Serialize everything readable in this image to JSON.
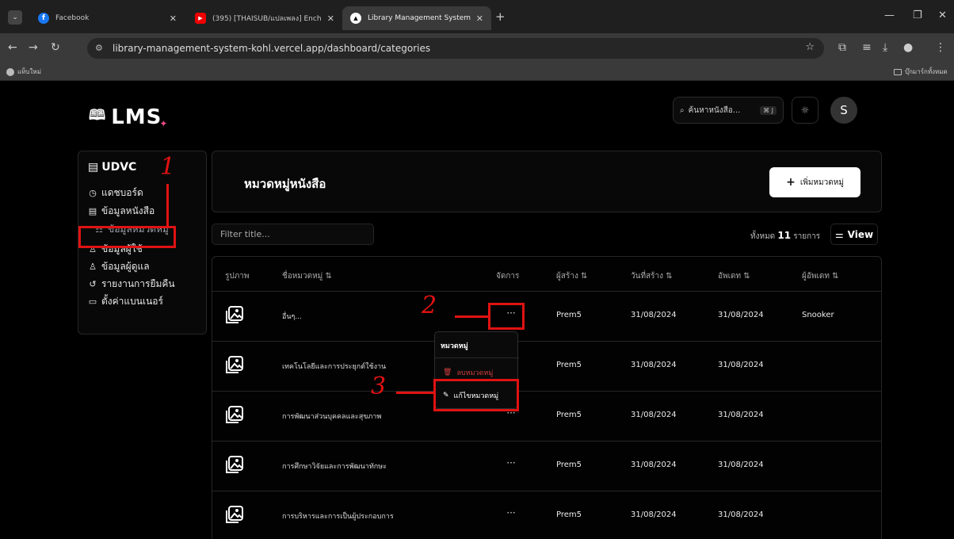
{
  "browser": {
    "tabs": [
      {
        "title": "Facebook",
        "favicon": "f"
      },
      {
        "title": "(395) [THAISUB/แปลเพลง] Ench",
        "favicon": "▶"
      },
      {
        "title": "Library Management System",
        "favicon": "▲"
      }
    ],
    "url": "library-management-system-kohl.vercel.app/dashboard/categories",
    "bookmark_left": "แท็บใหม่",
    "bookmark_right": "บุ๊กมาร์กทั้งหมด"
  },
  "app": {
    "logo_text": "LMS",
    "search_placeholder": "ค้นหาหนังสือ...",
    "search_shortcut": "⌘ J",
    "avatar_letter": "S"
  },
  "sidebar": {
    "title": "UDVC",
    "items": [
      {
        "label": "แดชบอร์ด",
        "icon": "◷"
      },
      {
        "label": "ข้อมูลหนังสือ",
        "icon": "▤"
      },
      {
        "label": "ข้อมูลหมวดหมู่",
        "icon": "☷"
      },
      {
        "label": "ข้อมูลผู้ใช้",
        "icon": "♙"
      },
      {
        "label": "ข้อมูลผู้ดูแล",
        "icon": "♙"
      },
      {
        "label": "รายงานการยืมคืน",
        "icon": "↺"
      },
      {
        "label": "ตั้งค่าแบนเนอร์",
        "icon": "▭"
      }
    ]
  },
  "main": {
    "title": "หมวดหมู่หนังสือ",
    "add_button": "เพิ่มหมวดหมู่",
    "filter_placeholder": "Filter title...",
    "total_prefix": "ทั้งหมด",
    "total_count": "11",
    "total_suffix": "รายการ",
    "view_button": "View",
    "columns": [
      "รูปภาพ",
      "ชื่อหมวดหมู่ ⇅",
      "จัดการ",
      "ผู้สร้าง ⇅",
      "วันที่สร้าง ⇅",
      "อัพเดท ⇅",
      "ผู้อัพเดท ⇅"
    ],
    "rows": [
      {
        "name": "อื่นๆ...",
        "creator": "Prem5",
        "created": "31/08/2024",
        "updated": "31/08/2024",
        "updater": "Snooker"
      },
      {
        "name": "เทคโนโลยีและการประยุกต์ใช้งาน",
        "creator": "Prem5",
        "created": "31/08/2024",
        "updated": "31/08/2024",
        "updater": ""
      },
      {
        "name": "การพัฒนาส่วนบุคคลและสุขภาพ",
        "creator": "Prem5",
        "created": "31/08/2024",
        "updated": "31/08/2024",
        "updater": ""
      },
      {
        "name": "การศึกษาวิจัยและการพัฒนาทักษะ",
        "creator": "Prem5",
        "created": "31/08/2024",
        "updated": "31/08/2024",
        "updater": ""
      },
      {
        "name": "การบริหารและการเป็นผู้ประกอบการ",
        "creator": "Prem5",
        "created": "31/08/2024",
        "updated": "31/08/2024",
        "updater": ""
      }
    ],
    "actions_glyph": "···"
  },
  "dropdown": {
    "label": "หมวดหมู่",
    "delete": "ลบหมวดหมู่",
    "edit": "แก้ไขหมวดหมู่"
  },
  "annotations": {
    "one": "1",
    "two": "2",
    "three": "3",
    "color": "#e01212"
  }
}
